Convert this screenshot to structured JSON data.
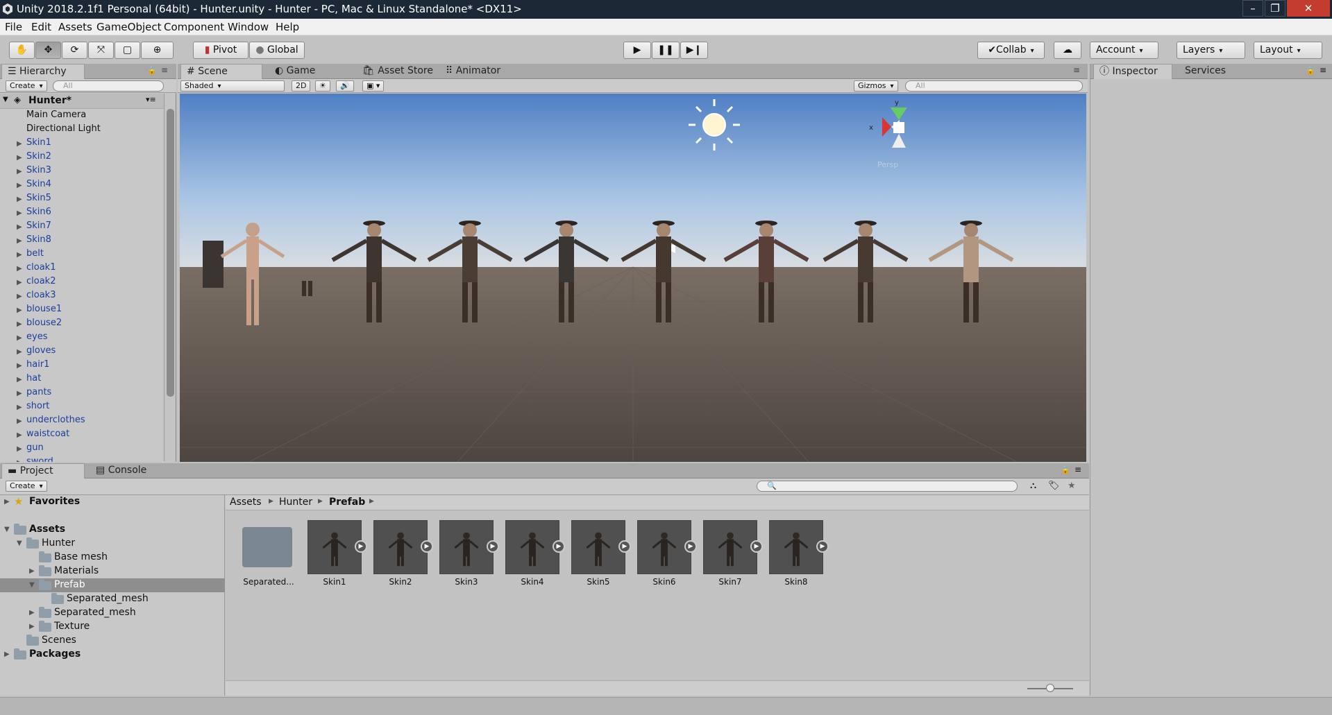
{
  "window": {
    "title": "Unity 2018.2.1f1 Personal (64bit) - Hunter.unity - Hunter - PC, Mac & Linux Standalone* <DX11>"
  },
  "menu": [
    "File",
    "Edit",
    "Assets",
    "GameObject",
    "Component",
    "Window",
    "Help"
  ],
  "toolbar": {
    "pivot": "Pivot",
    "global": "Global",
    "collab": "Collab",
    "account": "Account",
    "layers": "Layers",
    "layout": "Layout"
  },
  "hierarchy": {
    "tab": "Hierarchy",
    "create": "Create",
    "search_placeholder": "All",
    "scene": "Hunter*",
    "items": [
      "Main Camera",
      "Directional Light",
      "Skin1",
      "Skin2",
      "Skin3",
      "Skin4",
      "Skin5",
      "Skin6",
      "Skin7",
      "Skin8",
      "belt",
      "cloak1",
      "cloak2",
      "cloak3",
      "blouse1",
      "blouse2",
      "eyes",
      "gloves",
      "hair1",
      "hat",
      "pants",
      "short",
      "underclothes",
      "waistcoat",
      "gun",
      "sword"
    ]
  },
  "scene_view": {
    "tabs": [
      "Scene",
      "Game",
      "Asset Store",
      "Animator"
    ],
    "shading": "Shaded",
    "mode_2d": "2D",
    "gizmos": "Gizmos",
    "search_placeholder": "All",
    "gizmo_x": "x",
    "gizmo_y": "y",
    "persp": "Persp"
  },
  "inspector": {
    "tabs": [
      "Inspector",
      "Services"
    ]
  },
  "project": {
    "tabs": [
      "Project",
      "Console"
    ],
    "create": "Create",
    "favorites": "Favorites",
    "tree": [
      "Assets",
      "Hunter",
      "Base mesh",
      "Materials",
      "Prefab",
      "Separated_mesh",
      "Separated_mesh",
      "Texture",
      "Scenes",
      "Packages"
    ],
    "breadcrumb": [
      "Assets",
      "Hunter",
      "Prefab"
    ],
    "assets": [
      "Separated...",
      "Skin1",
      "Skin2",
      "Skin3",
      "Skin4",
      "Skin5",
      "Skin6",
      "Skin7",
      "Skin8"
    ]
  }
}
